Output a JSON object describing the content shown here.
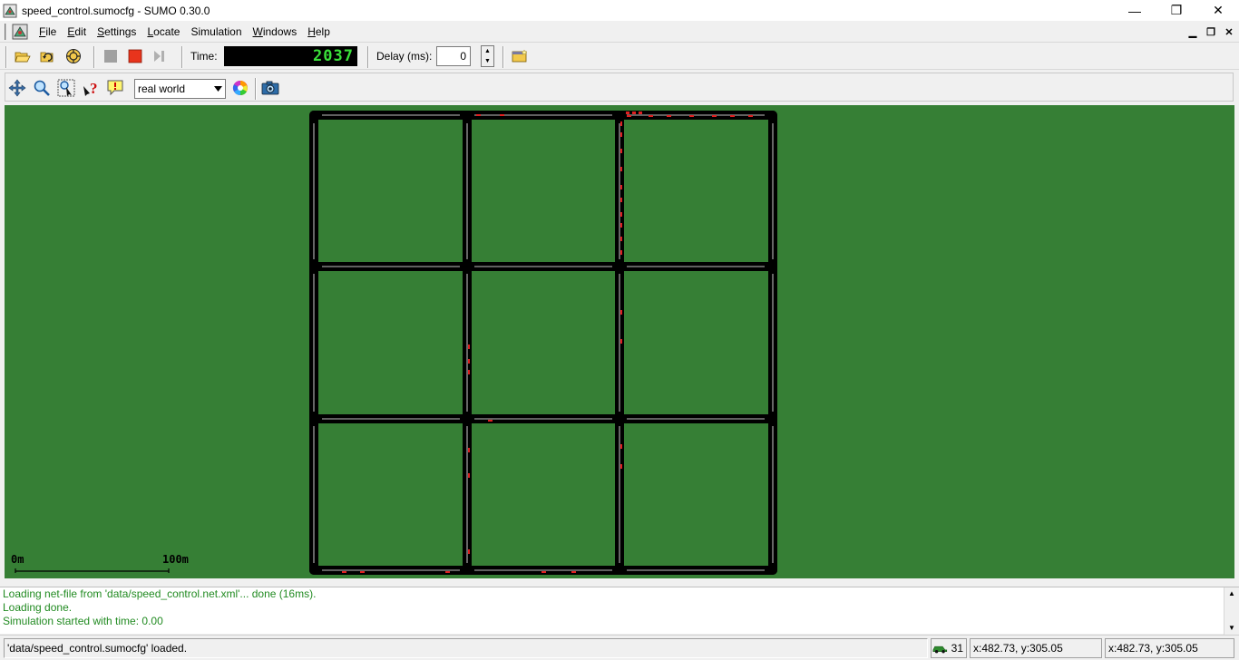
{
  "window": {
    "title": "speed_control.sumocfg - SUMO 0.30.0",
    "minimize_glyph": "—",
    "maximize_glyph": "❐",
    "close_glyph": "✕"
  },
  "menu": [
    {
      "label": "File",
      "mnemonic": "F",
      "rest": "ile"
    },
    {
      "label": "Edit",
      "mnemonic": "E",
      "rest": "dit"
    },
    {
      "label": "Settings",
      "mnemonic": "S",
      "rest": "ettings"
    },
    {
      "label": "Locate",
      "mnemonic": "L",
      "rest": "ocate"
    },
    {
      "label": "Simulation",
      "mnemonic": "",
      "rest": "Simulation"
    },
    {
      "label": "Windows",
      "mnemonic": "W",
      "rest": "indows"
    },
    {
      "label": "Help",
      "mnemonic": "H",
      "rest": "elp"
    }
  ],
  "toolbar": {
    "time_label": "Time:",
    "time_value": "2037",
    "delay_label": "Delay (ms):",
    "delay_value": "0",
    "icons": [
      "open-icon",
      "reload-icon",
      "recent-icon",
      "stop-icon",
      "run-icon",
      "step-icon",
      "new-view-icon"
    ]
  },
  "view_toolbar": {
    "scheme_value": "real world",
    "icons": [
      "recenter-icon",
      "zoom-icon",
      "locate-icon",
      "help-icon",
      "tooltip-icon",
      "color-wheel-icon",
      "screenshot-icon"
    ]
  },
  "canvas": {
    "background": "#367f35",
    "road_color": "#000000",
    "scale_start": "0m",
    "scale_end": "100m"
  },
  "log": {
    "lines": [
      "Loading net-file from 'data/speed_control.net.xml'... done (16ms).",
      "Loading done.",
      "Simulation started with time: 0.00"
    ],
    "color": "#228b22"
  },
  "status": {
    "message": "'data/speed_control.sumocfg' loaded.",
    "vehicle_count": "31",
    "coords_net": "x:482.73, y:305.05",
    "coords_geo": "x:482.73, y:305.05"
  }
}
